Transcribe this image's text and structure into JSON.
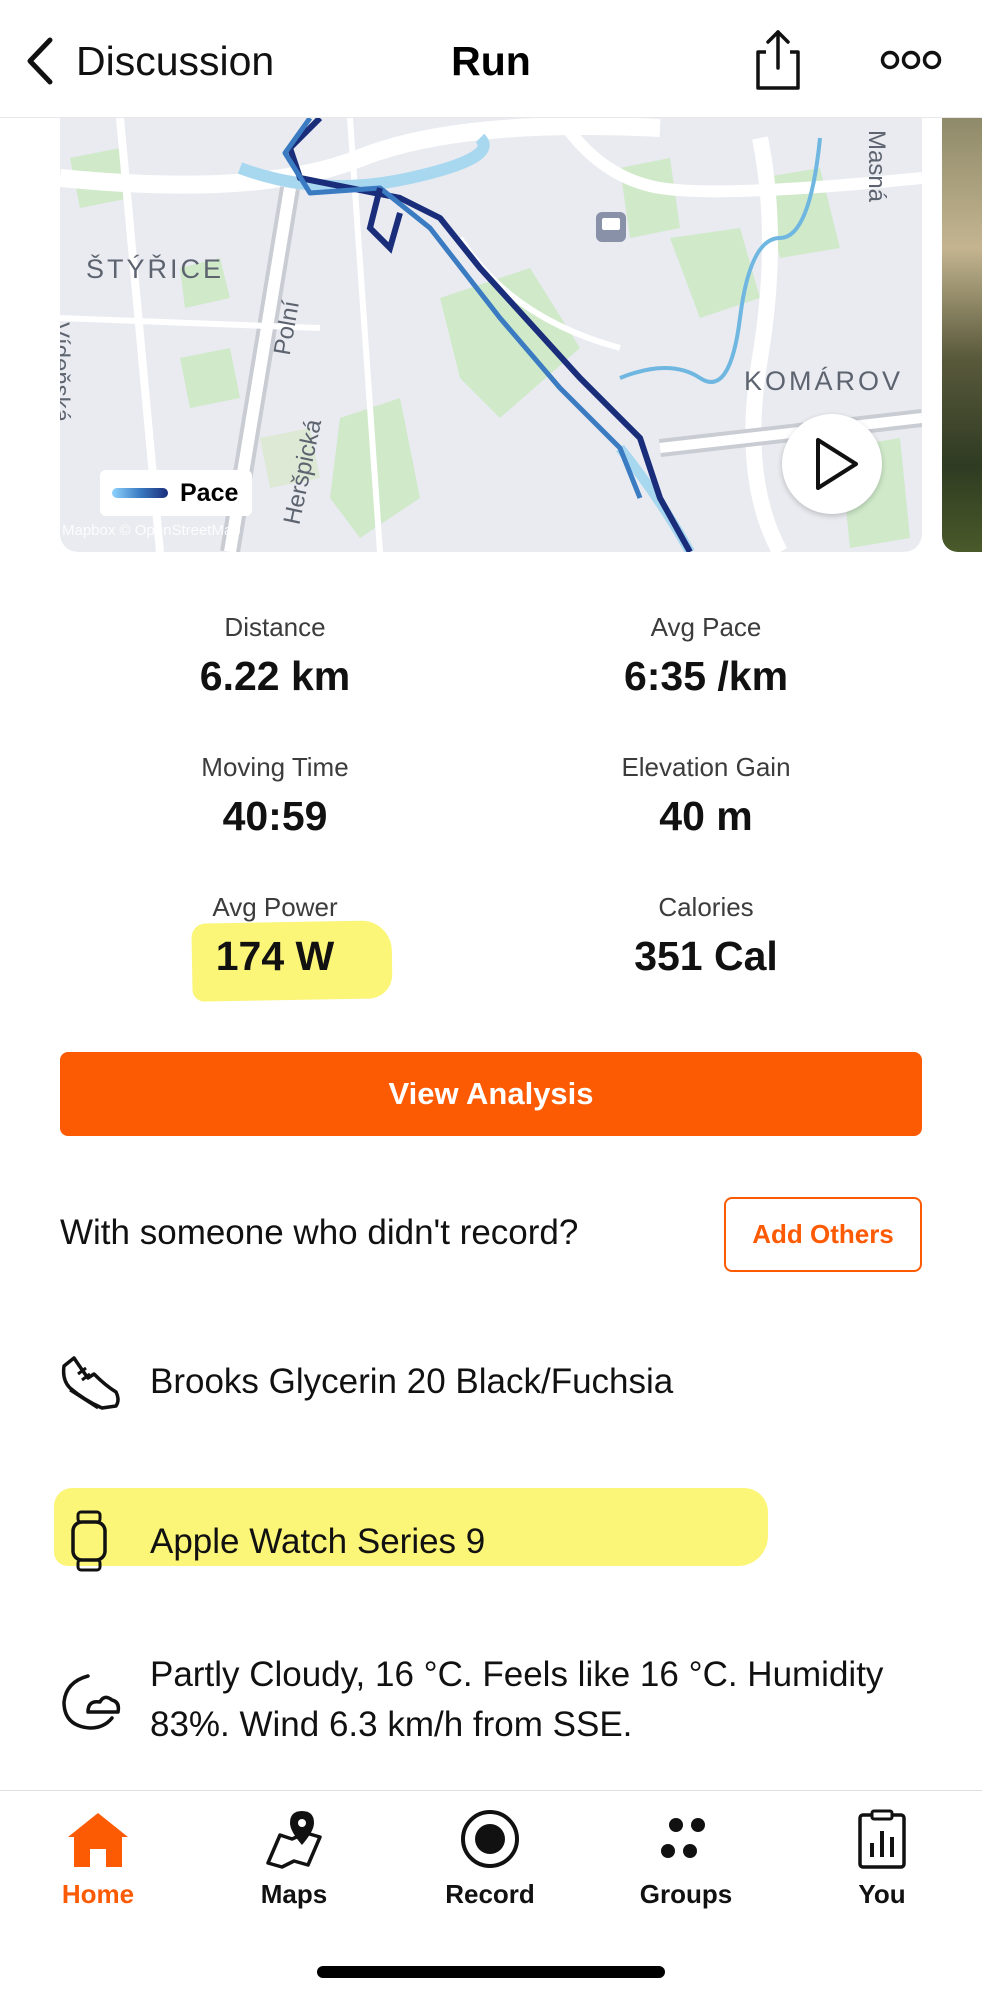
{
  "header": {
    "back_label": "Discussion",
    "title": "Run",
    "back_icon": "chevron-left-icon",
    "share_icon": "share-icon",
    "more_icon": "more-icon"
  },
  "map": {
    "area_labels": [
      "ŠTÝŘICE",
      "KOMÁROV"
    ],
    "street_labels": [
      "Polní",
      "Heršpická",
      "Masná",
      "Vídeňská"
    ],
    "legend_label": "Pace",
    "attribution": "Mapbox © OpenStreetMap",
    "play_icon": "play-icon"
  },
  "stats": [
    {
      "label": "Distance",
      "value": "6.22 km"
    },
    {
      "label": "Avg Pace",
      "value": "6:35 /km"
    },
    {
      "label": "Moving Time",
      "value": "40:59"
    },
    {
      "label": "Elevation Gain",
      "value": "40 m"
    },
    {
      "label": "Avg Power",
      "value": "174 W"
    },
    {
      "label": "Calories",
      "value": "351 Cal"
    }
  ],
  "actions": {
    "view_analysis": "View Analysis",
    "with_someone": "With someone who didn't record?",
    "add_others": "Add Others"
  },
  "gear": {
    "shoes": "Brooks Glycerin 20 Black/Fuchsia",
    "device": "Apple Watch Series 9"
  },
  "weather": {
    "text": "Partly Cloudy, 16 °C. Feels like 16 °C. Humidity 83%. Wind 6.3 km/h from SSE."
  },
  "tabbar": {
    "items": [
      {
        "label": "Home",
        "icon": "home-icon",
        "active": true
      },
      {
        "label": "Maps",
        "icon": "map-pin-icon",
        "active": false
      },
      {
        "label": "Record",
        "icon": "record-icon",
        "active": false
      },
      {
        "label": "Groups",
        "icon": "groups-icon",
        "active": false
      },
      {
        "label": "You",
        "icon": "clipboard-chart-icon",
        "active": false
      }
    ]
  },
  "colors": {
    "accent": "#fc5a03",
    "highlight": "#fbf578",
    "route_dark": "#1a2d7a",
    "route_light": "#8fd3ff"
  }
}
